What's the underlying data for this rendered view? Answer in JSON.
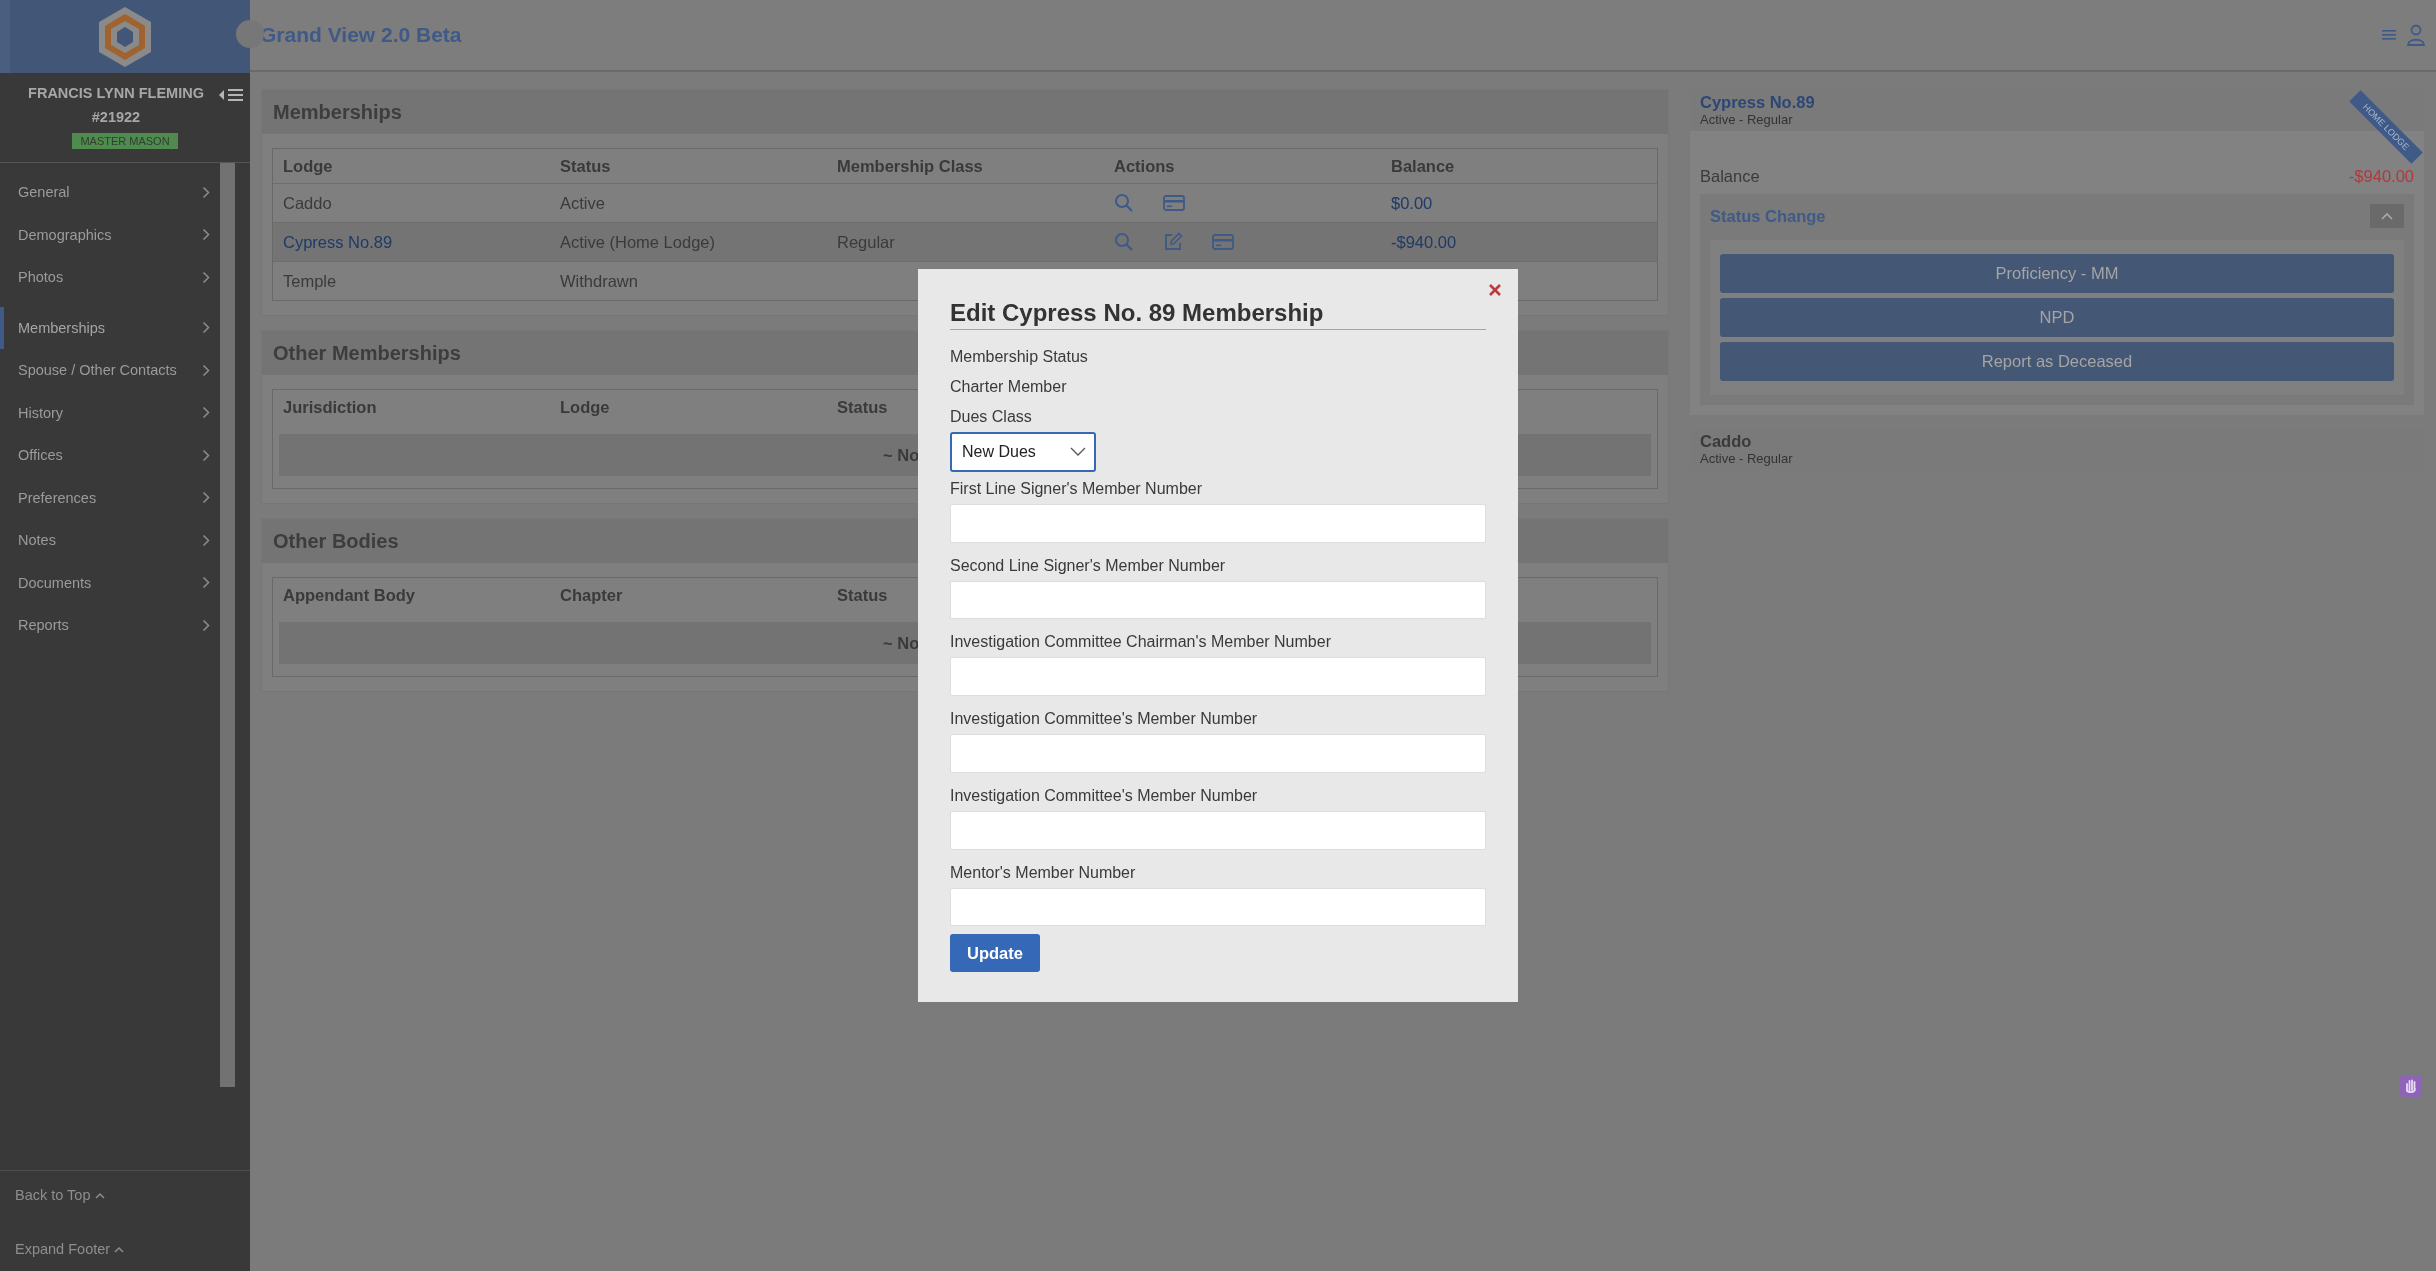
{
  "app": {
    "title": "Grand View 2.0 Beta"
  },
  "member": {
    "name": "FRANCIS LYNN FLEMING",
    "number": "#21922",
    "rank": "MASTER MASON"
  },
  "sidebar": {
    "items": [
      {
        "label": "General",
        "selected": false
      },
      {
        "label": "Demographics",
        "selected": false
      },
      {
        "label": "Photos",
        "selected": false
      },
      {
        "label": "Memberships",
        "selected": true
      },
      {
        "label": "Spouse / Other Contacts",
        "selected": false
      },
      {
        "label": "History",
        "selected": false
      },
      {
        "label": "Offices",
        "selected": false
      },
      {
        "label": "Preferences",
        "selected": false
      },
      {
        "label": "Notes",
        "selected": false
      },
      {
        "label": "Documents",
        "selected": false
      },
      {
        "label": "Reports",
        "selected": false
      }
    ],
    "footer": [
      "Back to Top",
      "Expand Footer"
    ]
  },
  "memberships": {
    "title": "Memberships",
    "columns": [
      "Lodge",
      "Status",
      "Membership Class",
      "Actions",
      "Balance"
    ],
    "rows": [
      {
        "lodge": "Caddo",
        "link": false,
        "status": "Active",
        "actions": [
          {
            "kind": "search"
          },
          {
            "kind": "card"
          }
        ],
        "balance": "$0.00"
      },
      {
        "lodge": "Cypress No.89",
        "link": true,
        "status": "Active  (Home Lodge)",
        "class": "Regular",
        "actions": [
          {
            "kind": "search"
          },
          {
            "kind": "edit"
          },
          {
            "kind": "card"
          }
        ],
        "balance": "-$940.00"
      },
      {
        "lodge": "Temple",
        "link": false,
        "status": "Withdrawn",
        "actions": []
      }
    ]
  },
  "other_memberships": {
    "title": "Other Memberships",
    "columns": [
      "Jurisdiction",
      "Lodge",
      "Status"
    ],
    "empty_text": "~ No"
  },
  "other_bodies": {
    "title": "Other Bodies",
    "columns": [
      "Appendant Body",
      "Chapter",
      "Status"
    ],
    "empty_text": "~ No"
  },
  "lodge_cards": [
    {
      "name": "Cypress No.89",
      "detail": "Active  - Regular",
      "expanded": true,
      "ribbon": "HOME LODGE",
      "balance_label": "Balance",
      "balance": "-$940.00",
      "status_change": {
        "title": "Status Change",
        "expanded": true,
        "buttons": [
          "Proficiency - MM",
          "NPD",
          "Report as Deceased"
        ]
      }
    },
    {
      "name": "Caddo",
      "detail": "Active  - Regular",
      "expanded": false
    }
  ],
  "modal": {
    "title": "Edit Cypress No.  89 Membership",
    "info": [
      "Membership Status",
      "Charter Member"
    ],
    "select_label": "Dues Class",
    "select_value": "New Dues",
    "fields": [
      "First Line Signer's Member Number",
      "Second Line Signer's Member Number",
      "Investigation Committee Chairman's Member Number",
      "Investigation Committee's Member Number",
      "Investigation Committee's Member Number",
      "Mentor's Member Number"
    ],
    "submit": "Update"
  }
}
